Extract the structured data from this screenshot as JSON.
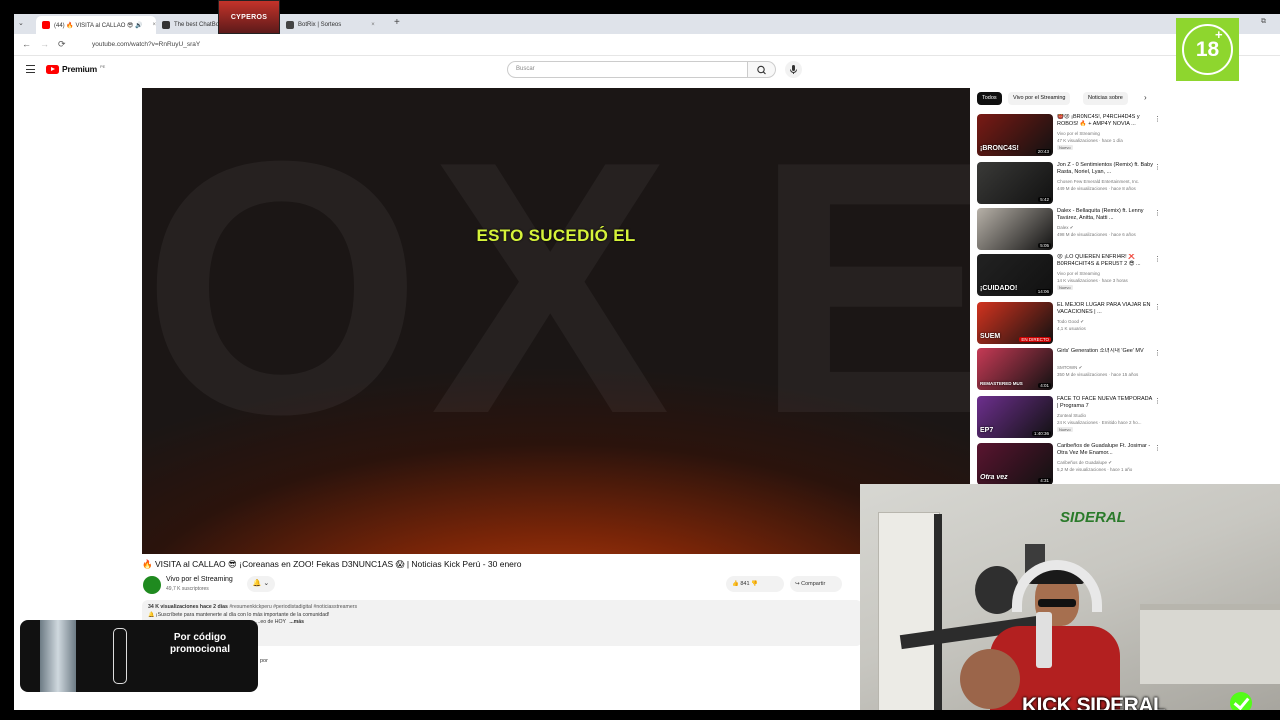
{
  "browser": {
    "tabs": [
      {
        "label": "(44) 🔥 VISITA al CALLAO 😎 🔊",
        "close": "×",
        "color": "#ff0000"
      },
      {
        "label": "The best ChatBot",
        "close": "",
        "color": "#333333"
      },
      {
        "label": "BotRix | Sorteos",
        "close": "×",
        "color": "#444444"
      }
    ],
    "new_tab": "+",
    "url": "youtube.com/watch?v=RnRuyU_sraY",
    "collapse_icon": "⌄",
    "back": "←",
    "forward": "→",
    "reload": "⟳",
    "window_controls": "⧉"
  },
  "youtube": {
    "logo_text": "Premium",
    "logo_sup": "PE",
    "search_placeholder": "Buscar",
    "caption": "ESTO SUCEDIÓ EL",
    "bg_letters": [
      "O",
      "X",
      "E"
    ],
    "video_title": "🔥 VISITA al CALLAO 😎 ¡Coreanas en ZOO! Fekas D3NUNC1AS 😱 | Noticias Kick Perú - 30 enero",
    "channel": {
      "name": "Vivo por el Streaming",
      "subs": "49,7 K suscriptores"
    },
    "bell": "🔔 ⌄",
    "likes": "👍  841      👎",
    "share": "↪  Compartir",
    "description": {
      "views": "34 K visualizaciones  hace 2 días",
      "tags": "#resumenkickperu #periodistadigital #noticiasstreamers",
      "line2": "🔔 ¡Suscríbete para mantenerte al día con lo más importante de la comunidad!",
      "line3": "...eo de HOY",
      "more": "...más"
    },
    "comments_fragment": "por",
    "chips": [
      "Todos",
      "Vivo por el Streaming",
      "Noticias sobre"
    ],
    "chip_next": "›",
    "recommendations": [
      {
        "title": "👹😡 ¡BR0NC4S!, P4RCH4D4S y ROBOS! 🔥 + AMP4Y NOVIA ...",
        "channel": "Vivo por el Streaming",
        "meta": "47 K visualizaciones · hace 1 día",
        "badge": "Nuevo",
        "duration": "20:43",
        "thumb_label": "¡BRONC4S!",
        "thumb_bg": "#7a1a14"
      },
      {
        "title": "Jon Z - 0 Sentimientos (Remix) ft. Baby Rasta, Noriel, Lyan, ...",
        "channel": "Chosen Few Emerald Entertainment, Inc.",
        "meta": "449 M de visualizaciones · hace 8 años",
        "badge": "",
        "duration": "5:42",
        "thumb_label": "",
        "thumb_bg": "#3a3a38"
      },
      {
        "title": "Dalex - Bellaquita (Remix) ft. Lenny Tavárez, Anitta, Natti ...",
        "channel": "Dalex ✔",
        "meta": "498 M de visualizaciones · hace 6 años",
        "badge": "",
        "duration": "5:05",
        "thumb_label": "",
        "thumb_bg": "#b7b1a8"
      },
      {
        "title": "😡 ¡LO QUIEREN ENFRI4R! ❌ B0RR4CHIT4S & PERU5T 2 😎 ...",
        "channel": "Vivo por el Streaming",
        "meta": "14 K visualizaciones · hace 3 horas",
        "badge": "Nuevo",
        "duration": "14:06",
        "thumb_label": "¡CUIDADO!",
        "thumb_bg": "#222222"
      },
      {
        "title": "EL MEJOR LUGAR PARA VIAJAR EN VACACIONES | ...",
        "channel": "Todo Good ✔",
        "meta": "4,1 K usuarios",
        "badge": "",
        "duration": "EN DIRECTO",
        "thumb_label": "SUEM",
        "thumb_bg": "#d2331f"
      },
      {
        "title": "Girls' Generation 소녀시대 'Gee' MV",
        "channel": "SMTOWN ✔",
        "meta": "350 M de visualizaciones · hace 15 años",
        "badge": "",
        "duration": "4:01",
        "thumb_label": "REMASTERED MUS",
        "thumb_bg": "#c63a55"
      },
      {
        "title": "FACE TO FACE NUEVA TEMPORADA | Programa 7",
        "channel": "Zonteal Studio",
        "meta": "24 K visualizaciones · Emitido hace 2 ho...",
        "badge": "Nuevo",
        "duration": "1:40:36",
        "thumb_label": "EP7",
        "thumb_bg": "#6d2f8e"
      },
      {
        "title": "Caribeños de Guadalupe Ft. Josimar - Otra Vez Me Enamor...",
        "channel": "Caribeños de Guadalupe ✔",
        "meta": "5,2 M de visualizaciones · hace 1 año",
        "badge": "",
        "duration": "4:31",
        "thumb_label": "Otra vez",
        "thumb_bg": "#5a1430"
      }
    ]
  },
  "overlays": {
    "age_badge": {
      "num": "18",
      "plus": "+",
      "color": "#8ed62e"
    },
    "logo_sticker": "CYPEROS",
    "kick_label": "KICK SIDERAL",
    "webcam_mural": "SIDERAL",
    "promo_text": "Por código promocional",
    "brand_green": "#53fc18"
  }
}
